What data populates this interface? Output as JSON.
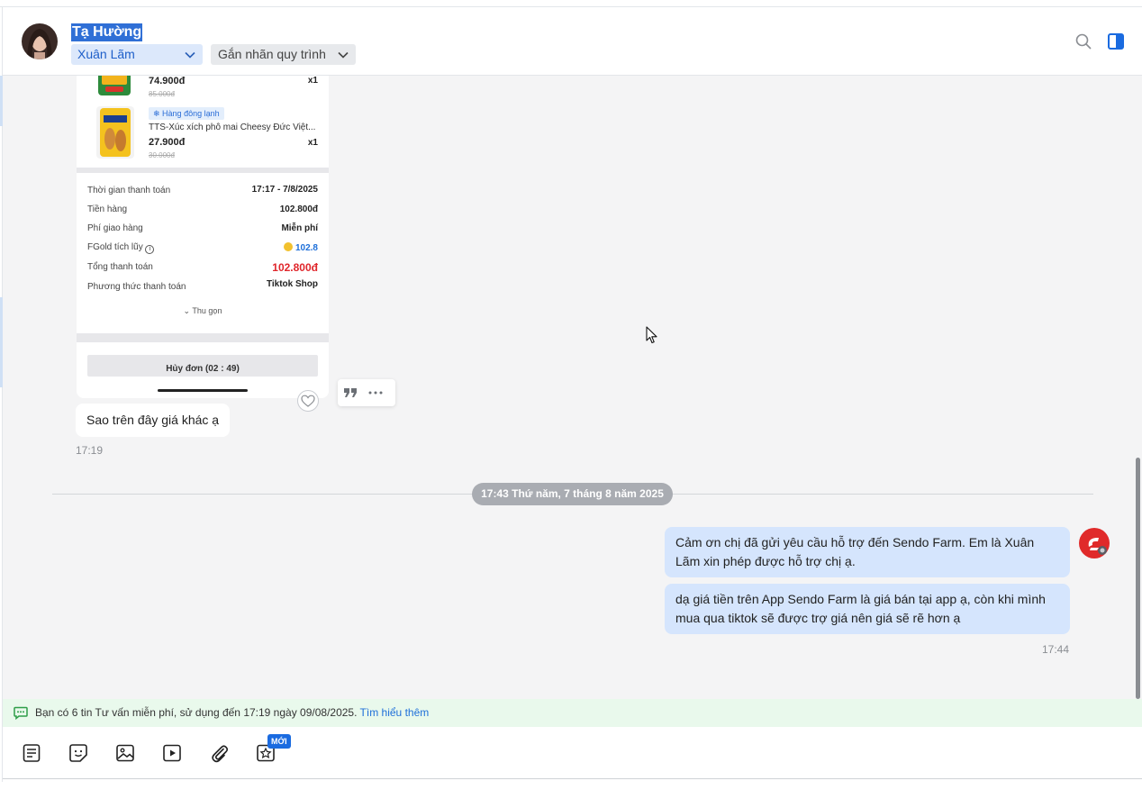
{
  "header": {
    "contact_name": "Tạ Hường",
    "assignee": "Xuân Lãm",
    "workflow_label": "Gắn nhãn quy trình"
  },
  "receipt": {
    "items": [
      {
        "price": "74.900đ",
        "old_price": "85.000đ",
        "qty": "x1"
      },
      {
        "tag": "Hàng đông lạnh",
        "name": "TTS-Xúc xích phô mai Cheesy Đức Việt...",
        "price": "27.900đ",
        "old_price": "30.000đ",
        "qty": "x1"
      }
    ],
    "rows": [
      {
        "label": "Thời gian thanh toán",
        "value": "17:17 - 7/8/2025"
      },
      {
        "label": "Tiền hàng",
        "value": "102.800đ"
      },
      {
        "label": "Phí giao hàng",
        "value": "Miễn phí"
      },
      {
        "label": "FGold tích lũy",
        "value": "102.8"
      },
      {
        "label": "Tổng thanh toán",
        "value": "102.800đ"
      },
      {
        "label": "Phương thức thanh toán",
        "value": "Tiktok Shop"
      }
    ],
    "collapse_label": "Thu gọn",
    "cancel_label": "Hủy đơn (02 : 49)"
  },
  "messages": {
    "incoming_text": "Sao trên đây giá khác ạ",
    "incoming_time": "17:19",
    "date_separator": "17:43 Thứ năm, 7 tháng 8 năm 2025",
    "outgoing": [
      "Cảm ơn chị đã gửi yêu cầu hỗ trợ đến Sendo Farm. Em là Xuân Lãm xin phép được hỗ trợ chị ạ.",
      "dạ giá tiền trên App Sendo Farm là giá bán tại app ạ, còn khi mình mua qua tiktok sẽ được trợ giá nên giá sẽ rẽ hơn ạ"
    ],
    "outgoing_time": "17:44"
  },
  "notice": {
    "text": "Bạn có 6 tin Tư vấn miễn phí, sử dụng đến 17:19 ngày 09/08/2025. ",
    "link": "Tìm hiểu thêm"
  },
  "toolbar": {
    "new_badge": "MỚI"
  },
  "colors": {
    "accent": "#1a6be0",
    "outgoing_bubble": "#d5e5fd",
    "notice_bg": "#e9f9ec",
    "total_red": "#e0262b"
  }
}
